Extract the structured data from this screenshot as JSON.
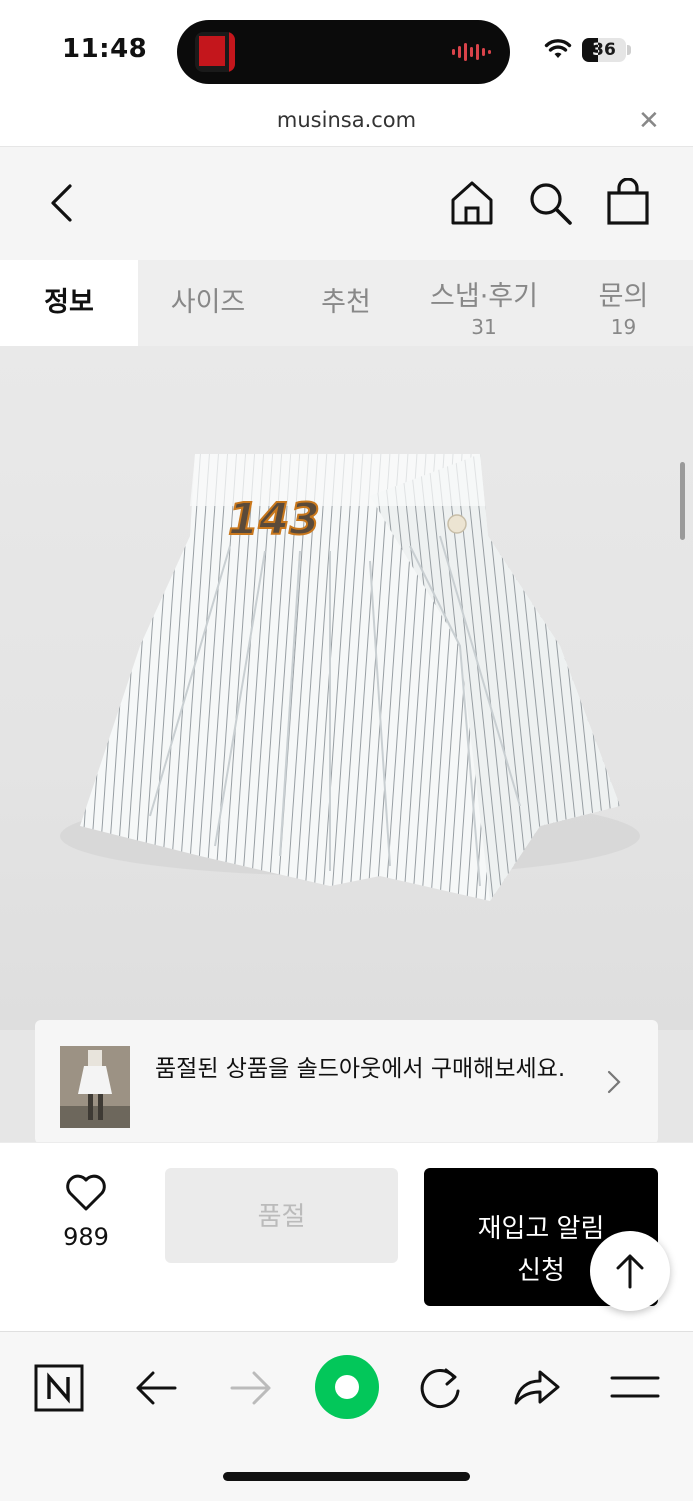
{
  "status_bar": {
    "time": "11:48",
    "battery": "36"
  },
  "browser": {
    "url": "musinsa.com"
  },
  "tabs": [
    {
      "label": "정보",
      "count": ""
    },
    {
      "label": "사이즈",
      "count": ""
    },
    {
      "label": "추천",
      "count": ""
    },
    {
      "label": "스냅·후기",
      "count": "31"
    },
    {
      "label": "문의",
      "count": "19"
    }
  ],
  "product": {
    "patch_number": "143"
  },
  "soldout_banner": {
    "text": "품절된 상품을 솔드아웃에서 구매해보세요."
  },
  "actions": {
    "like_count": "989",
    "soldout_label": "품절",
    "restock_line1": "재입고 알림",
    "restock_line2": "신청"
  },
  "colors": {
    "accent_green": "#03c75a",
    "primary_button": "#000000"
  }
}
